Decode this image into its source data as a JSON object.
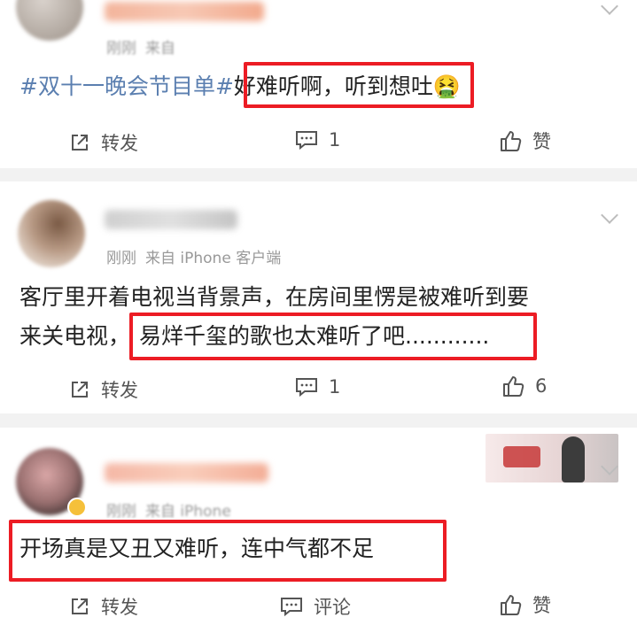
{
  "posts": [
    {
      "time": "刚刚",
      "source": "来自",
      "hashtag": "#双十一晚会节目单#",
      "text_highlight": "好难听啊，听到想吐",
      "emoji": "🤮",
      "actions": {
        "repost": "转发",
        "comment": "1",
        "like": "赞"
      }
    },
    {
      "time": "刚刚",
      "source": "来自 iPhone 客户端",
      "line1": "客厅里开着电视当背景声，在房间里愣是被难听到要",
      "line2_plain": "来关电视，",
      "line2_highlight": "易烊千玺的歌也太难听了吧............",
      "actions": {
        "repost": "转发",
        "comment": "1",
        "like": "6"
      }
    },
    {
      "time": "刚刚",
      "source": "来自 iPhone",
      "text_highlight": "开场真是又丑又难听，连中气都不足",
      "actions": {
        "repost": "转发",
        "comment": "评论",
        "like": "赞"
      }
    }
  ],
  "colors": {
    "highlight_border": "#ec1c24",
    "hashtag": "#5b7fb0",
    "meta": "#999999"
  },
  "icons": {
    "repost": "share-square-icon",
    "comment": "comment-bubble-icon",
    "like": "thumbs-up-icon",
    "menu": "chevron-down-icon"
  }
}
